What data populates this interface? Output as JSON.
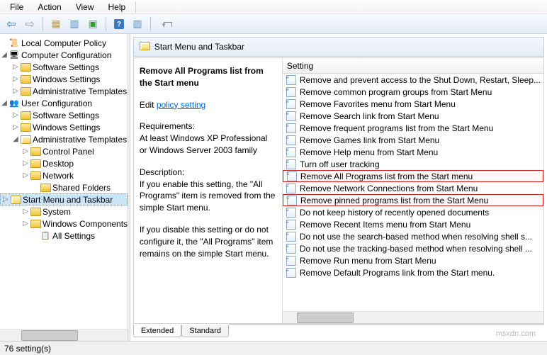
{
  "menu": {
    "file": "File",
    "action": "Action",
    "view": "View",
    "help": "Help"
  },
  "tree": {
    "root": "Local Computer Policy",
    "comp": "Computer Configuration",
    "comp_sw": "Software Settings",
    "comp_win": "Windows Settings",
    "comp_adm": "Administrative Templates",
    "user": "User Configuration",
    "user_sw": "Software Settings",
    "user_win": "Windows Settings",
    "user_adm": "Administrative Templates",
    "cp": "Control Panel",
    "desktop": "Desktop",
    "network": "Network",
    "shared": "Shared Folders",
    "startmenu": "Start Menu and Taskbar",
    "system": "System",
    "wincomp": "Windows Components",
    "allset": "All Settings"
  },
  "header": {
    "title": "Start Menu and Taskbar"
  },
  "desc": {
    "title": "Remove All Programs list from the Start menu",
    "edit_prefix": "Edit ",
    "edit_link": "policy setting ",
    "req_label": "Requirements:",
    "req_body": "At least Windows XP Professional or Windows Server 2003 family",
    "desc_label": "Description:",
    "desc_body1": "If you enable this setting, the \"All Programs\" item is removed from the simple Start menu.",
    "desc_body2": "If you disable this setting or do not configure it, the \"All Programs\" item remains on the simple Start menu."
  },
  "settings": {
    "header": "Setting",
    "items": [
      "Remove and prevent access to the Shut Down, Restart, Sleep...",
      "Remove common program groups from Start Menu",
      "Remove Favorites menu from Start Menu",
      "Remove Search link from Start Menu",
      "Remove frequent programs list from the Start Menu",
      "Remove Games link from Start Menu",
      "Remove Help menu from Start Menu",
      "Turn off user tracking",
      "Remove All Programs list from the Start menu",
      "Remove Network Connections from Start Menu",
      "Remove pinned programs list from the Start Menu",
      "Do not keep history of recently opened documents",
      "Remove Recent Items menu from Start Menu",
      "Do not use the search-based method when resolving shell s...",
      "Do not use the tracking-based method when resolving shell ...",
      "Remove Run menu from Start Menu",
      "Remove Default Programs link from the Start menu."
    ],
    "highlighted": [
      8,
      10
    ]
  },
  "tabs": {
    "extended": "Extended",
    "standard": "Standard"
  },
  "status": "76 setting(s)",
  "watermark": "msxdn.com"
}
